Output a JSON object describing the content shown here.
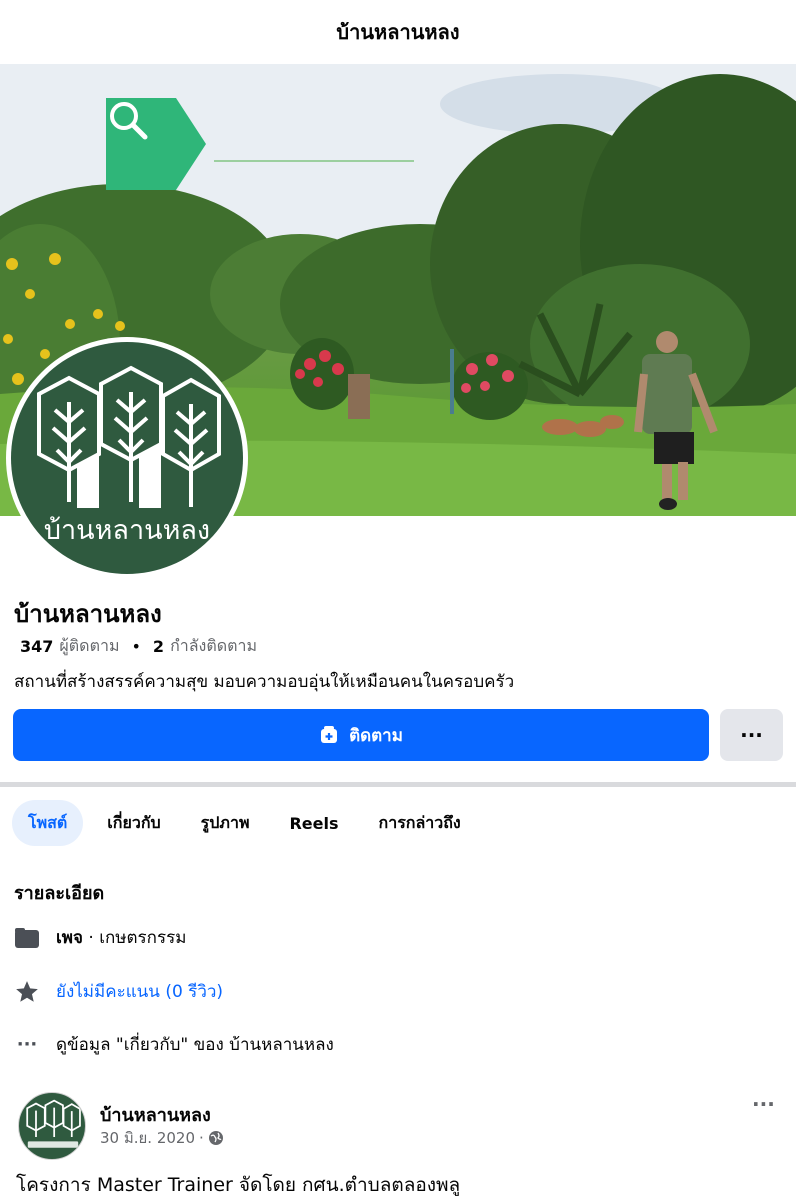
{
  "header": {
    "title": "บ้านหลานหลง"
  },
  "cover": {
    "search_text": "บ้านหลานหลง",
    "icon": "search-icon",
    "accent": "#2fb679"
  },
  "profile": {
    "avatar_label": "บ้านหลานหลง",
    "name": "บ้านหลานหลง",
    "followers_count": "347",
    "followers_label": "ผู้ติดตาม",
    "separator": "•",
    "following_count": "2",
    "following_label": "กำลังติดตาม",
    "bio": "สถานที่สร้างสรรค์ความสุข มอบความอบอุ่นให้เหมือนคนในครอบครัว"
  },
  "actions": {
    "follow_label": "ติดตาม",
    "follow_icon": "follow-icon",
    "more_label": "···",
    "primary_color": "#0866ff"
  },
  "tabs": [
    {
      "label": "โพสต์",
      "active": true
    },
    {
      "label": "เกี่ยวกับ",
      "active": false
    },
    {
      "label": "รูปภาพ",
      "active": false
    },
    {
      "label": "Reels",
      "active": false
    },
    {
      "label": "การกล่าวถึง",
      "active": false
    }
  ],
  "details": {
    "title": "รายละเอียด",
    "page_type_bold": "เพจ",
    "page_type_rest": " · เกษตรกรรม",
    "rating": "ยังไม่มีคะแนน (0 รีวิว)",
    "about_link": "ดูข้อมูล \"เกี่ยวกับ\" ของ บ้านหลานหลง"
  },
  "post": {
    "author": "บ้านหลานหลง",
    "date": "30 มิ.ย. 2020",
    "dot": "·",
    "privacy_icon": "globe-icon",
    "more_label": "···",
    "text": "โครงการ Master Trainer จัดโดย กศน.ตำบลตลองพลู"
  }
}
